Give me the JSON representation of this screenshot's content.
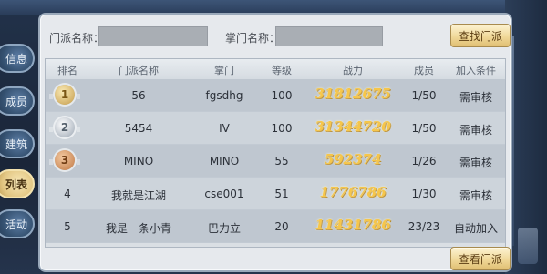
{
  "tabs": [
    {
      "label": "信息",
      "active": false
    },
    {
      "label": "成员",
      "active": false
    },
    {
      "label": "建筑",
      "active": false
    },
    {
      "label": "列表",
      "active": true
    },
    {
      "label": "活动",
      "active": false
    }
  ],
  "search": {
    "sect_name_label": "门派名称：",
    "sect_name_value": "",
    "leader_name_label": "掌门名称：",
    "leader_name_value": "",
    "find_button": "查找门派"
  },
  "table": {
    "headers": [
      "排名",
      "门派名称",
      "掌门",
      "等级",
      "战力",
      "成员",
      "加入条件"
    ],
    "rows": [
      {
        "rank": "1",
        "medal": "gold",
        "name": "56",
        "leader": "fgsdhg",
        "level": "100",
        "power": "31812675",
        "members": "1/50",
        "condition": "需审核"
      },
      {
        "rank": "2",
        "medal": "silver",
        "name": "5454",
        "leader": "IV",
        "level": "100",
        "power": "31344720",
        "members": "1/50",
        "condition": "需审核"
      },
      {
        "rank": "3",
        "medal": "bronze",
        "name": "MINO",
        "leader": "MINO",
        "level": "55",
        "power": "592374",
        "members": "1/26",
        "condition": "需审核"
      },
      {
        "rank": "4",
        "medal": "",
        "name": "我就是江湖",
        "leader": "cse001",
        "level": "51",
        "power": "1776786",
        "members": "1/30",
        "condition": "需审核"
      },
      {
        "rank": "5",
        "medal": "",
        "name": "我是一条小青",
        "leader": "巴力立",
        "level": "20",
        "power": "11431786",
        "members": "23/23",
        "condition": "自动加入"
      }
    ]
  },
  "view_button": "查看门派",
  "colors": {
    "power_text": "#f6c64a",
    "button_gold": "#f0d899"
  }
}
